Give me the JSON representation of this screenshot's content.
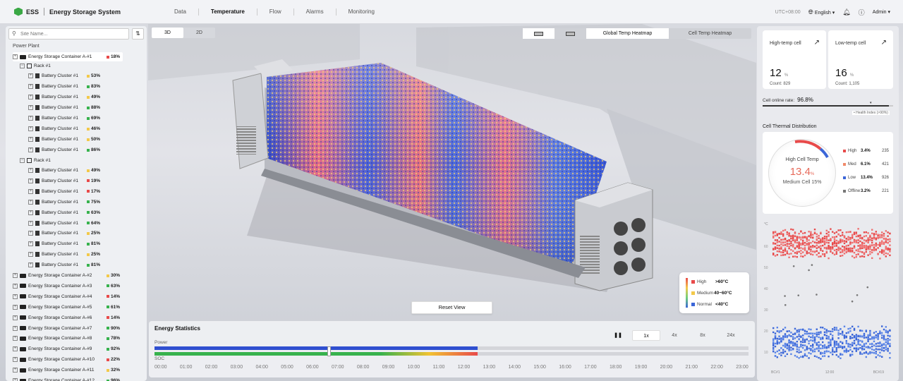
{
  "header": {
    "brand": "ESS",
    "app_title": "Energy Storage System",
    "nav": [
      "Data",
      "Temperature",
      "Flow",
      "Alarms",
      "Monitoring"
    ],
    "active_nav": "Temperature",
    "timezone": "UTC+08:00",
    "language": "English ▾",
    "user": "Admin ▾"
  },
  "sidebar": {
    "search_placeholder": "Site Name...",
    "tree_title": "Power Plant",
    "rack_label": "Rack #1",
    "cluster_label": "Battery Cluster #1",
    "selected_container": {
      "name": "Energy Storage Container A-#1",
      "pct": "18%"
    },
    "rack1_clusters": [
      "53%",
      "83%",
      "49%",
      "88%",
      "69%",
      "46%",
      "50%",
      "86%"
    ],
    "rack2_clusters": [
      "49%",
      "19%",
      "17%",
      "75%",
      "63%",
      "64%",
      "25%",
      "81%",
      "25%",
      "81%"
    ],
    "containers": [
      {
        "name": "Energy Storage Container A-#2",
        "pct": "30%"
      },
      {
        "name": "Energy Storage Container A-#3",
        "pct": "63%"
      },
      {
        "name": "Energy Storage Container A-#4",
        "pct": "14%"
      },
      {
        "name": "Energy Storage Container A-#5",
        "pct": "61%"
      },
      {
        "name": "Energy Storage Container A-#6",
        "pct": "14%"
      },
      {
        "name": "Energy Storage Container A-#7",
        "pct": "90%"
      },
      {
        "name": "Energy Storage Container A-#8",
        "pct": "78%"
      },
      {
        "name": "Energy Storage Container A-#9",
        "pct": "92%"
      },
      {
        "name": "Energy Storage Container A-#10",
        "pct": "22%"
      },
      {
        "name": "Energy Storage Container A-#11",
        "pct": "32%"
      },
      {
        "name": "Energy Storage Container A-#12",
        "pct": "96%"
      }
    ]
  },
  "view": {
    "toggle": [
      "3D",
      "2D"
    ],
    "active_toggle": "3D",
    "heatmap_tabs": [
      "Global Temp Heatmap",
      "Cell Temp Heatmap"
    ],
    "active_heatmap": "Global Temp Heatmap",
    "reset_label": "Reset View",
    "legend": [
      {
        "label": "High",
        "value": ">60°C",
        "color": "#e84a4a"
      },
      {
        "label": "Medium",
        "value": "40~60°C",
        "color": "#f3c94a"
      },
      {
        "label": "Normal",
        "value": "<40°C",
        "color": "#3b66d8"
      }
    ]
  },
  "energy": {
    "title": "Energy Statistics",
    "power_label": "Power",
    "soc_label": "SOC",
    "pause_label": "❚❚",
    "speeds": [
      "1x",
      "4x",
      "8x",
      "24x"
    ],
    "active_speed": "1x",
    "progress": 0.545,
    "times": [
      "00:00",
      "01:00",
      "02:00",
      "03:00",
      "04:00",
      "05:00",
      "06:00",
      "07:00",
      "08:00",
      "09:00",
      "10:00",
      "11:00",
      "12:00",
      "13:00",
      "14:00",
      "15:00",
      "16:00",
      "17:00",
      "18:00",
      "19:00",
      "20:00",
      "21:00",
      "22:00",
      "23:00"
    ]
  },
  "right": {
    "high_card": {
      "title": "High-temp cell",
      "value": "12",
      "unit": "%",
      "count": "Count: 829"
    },
    "low_card": {
      "title": "Low-temp cell",
      "value": "16",
      "unit": "%",
      "count": "Count: 1,105"
    },
    "online_rate_label": "Cell online rate:",
    "online_rate_value": "96.8%",
    "health_label": "• Health Index (>90%)",
    "dist_title": "Cell Thermal Distribution",
    "donut_label": "High Cell Temp",
    "donut_value": "13.4",
    "donut_unit": "%",
    "donut_sub": "Medium Cell 15%",
    "dist_rows": [
      {
        "label": "High",
        "pct": "3.4%",
        "count": "235",
        "color": "#e84a4a"
      },
      {
        "label": "Med",
        "pct": "6.1%",
        "count": "421",
        "color": "#f08a6a"
      },
      {
        "label": "Low",
        "pct": "13.4%",
        "count": "926",
        "color": "#3b66d8"
      },
      {
        "label": "Offline",
        "pct": "3.2%",
        "count": "221",
        "color": "#777777"
      }
    ],
    "heat_unit": "°C",
    "heat_y": [
      "60",
      "50",
      "40",
      "30",
      "20",
      "10"
    ],
    "heat_x": [
      "BC#1",
      "12:00",
      "BC#19"
    ]
  }
}
